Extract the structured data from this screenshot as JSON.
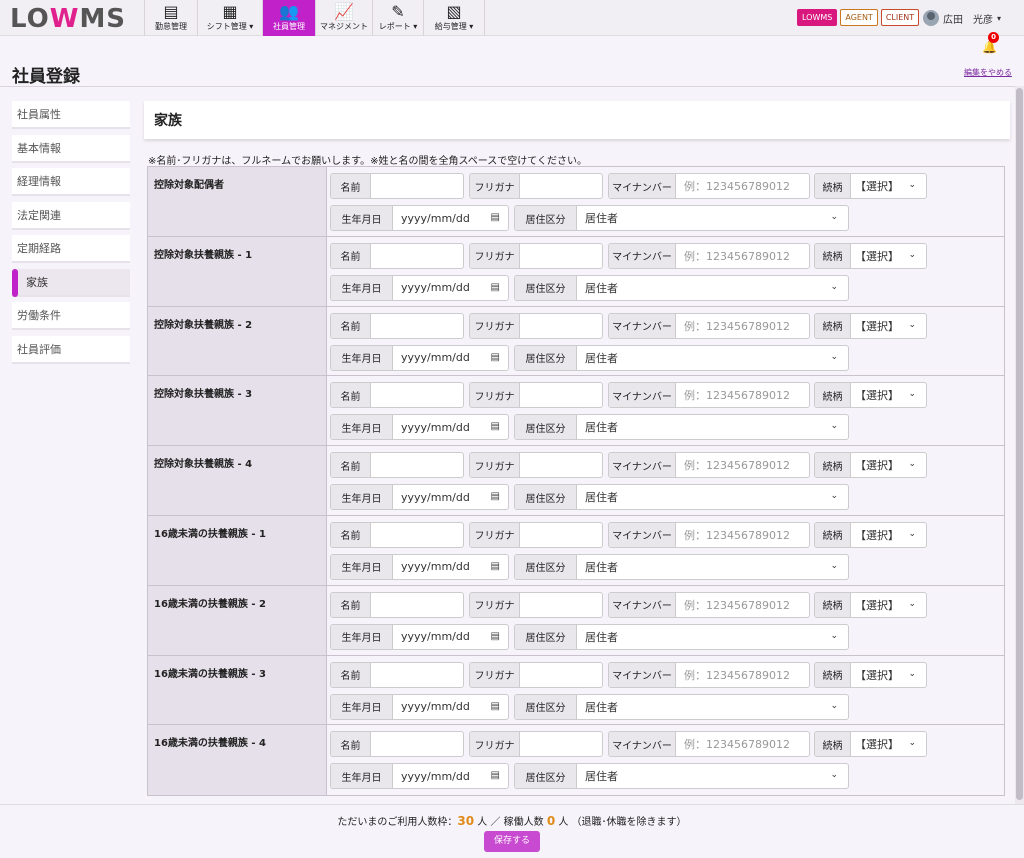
{
  "logo": {
    "l": "LO",
    "w": "W",
    "r": "MS"
  },
  "nav": [
    {
      "icon": "clipboard-icon",
      "glyph": "▤",
      "label": "勤怠管理"
    },
    {
      "icon": "calendar-icon",
      "glyph": "▦",
      "label": "シフト管理 ▾"
    },
    {
      "icon": "users-icon",
      "glyph": "👥",
      "label": "社員管理"
    },
    {
      "icon": "chart-icon",
      "glyph": "📈",
      "label": "マネジメント"
    },
    {
      "icon": "report-icon",
      "glyph": "✎",
      "label": "レポート ▾"
    },
    {
      "icon": "payroll-icon",
      "glyph": "▧",
      "label": "給与管理 ▾"
    }
  ],
  "badges": {
    "lowms": "LOWMS",
    "agent": "AGENT",
    "client": "CLIENT"
  },
  "user": {
    "name": "広田　光彦",
    "caret": "▾"
  },
  "notifications": {
    "count": "0"
  },
  "page": {
    "title": "社員登録",
    "cancel": "編集をやめる"
  },
  "sidebar": [
    {
      "label": "社員属性",
      "active": false
    },
    {
      "label": "基本情報",
      "active": false
    },
    {
      "label": "経理情報",
      "active": false
    },
    {
      "label": "法定関連",
      "active": false
    },
    {
      "label": "定期経路",
      "active": false
    },
    {
      "label": "家族",
      "active": true
    },
    {
      "label": "労働条件",
      "active": false
    },
    {
      "label": "社員評価",
      "active": false
    }
  ],
  "section": {
    "title": "家族",
    "notice": "※名前･フリガナは、フルネームでお願いします。※姓と名の間を全角スペースで空けてください。"
  },
  "fields": {
    "name_label": "名前",
    "kana_label": "フリガナ",
    "mynumber_label": "マイナンバー",
    "mynumber_placeholder": "例：123456789012",
    "relation_label": "続柄",
    "relation_value": "【選択】",
    "dob_label": "生年月日",
    "dob_placeholder": "yyyy/mm/dd",
    "residence_label": "居住区分",
    "residence_value": "居住者"
  },
  "rows": [
    {
      "label": "控除対象配偶者"
    },
    {
      "label": "控除対象扶養親族 - 1"
    },
    {
      "label": "控除対象扶養親族 - 2"
    },
    {
      "label": "控除対象扶養親族 - 3"
    },
    {
      "label": "控除対象扶養親族 - 4"
    },
    {
      "label": "16歳未満の扶養親族 - 1"
    },
    {
      "label": "16歳未満の扶養親族 - 2"
    },
    {
      "label": "16歳未満の扶養親族 - 3"
    },
    {
      "label": "16歳未満の扶養親族 - 4"
    }
  ],
  "footer": {
    "prefix": "ただいまのご利用人数枠：",
    "quota": "30",
    "unit1": " 人 ／ 稼働人数 ",
    "active": "0",
    "unit2": " 人 （退職･休職を除きます）",
    "save": "保存する"
  },
  "colors": {
    "accent": "#c021c8",
    "brand_pink": "#e0208c",
    "number": "#e08a1a"
  }
}
